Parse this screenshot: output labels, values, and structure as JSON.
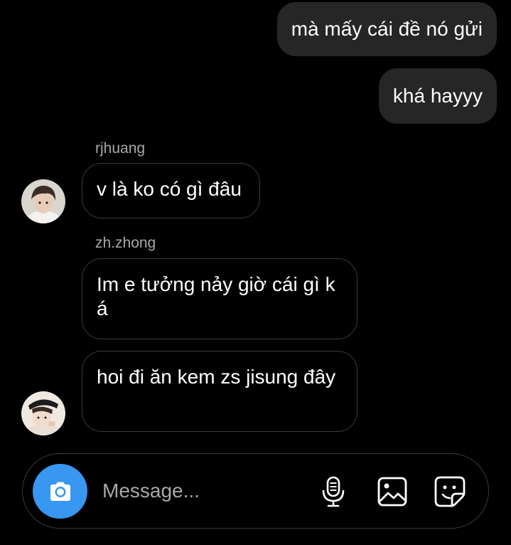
{
  "messages": [
    {
      "type": "outgoing",
      "text": "mà mấy cái đề nó gửi"
    },
    {
      "type": "outgoing",
      "text": "khá hayyy"
    },
    {
      "type": "sender",
      "text": "rjhuang"
    },
    {
      "type": "incoming",
      "text": "v là ko có gì đâu"
    },
    {
      "type": "sender",
      "text": "zh.zhong"
    },
    {
      "type": "incoming",
      "text": "Im e tưởng nảy giờ cái gì k á"
    },
    {
      "type": "incoming",
      "text": "hoi đi ăn kem zs jisung đây"
    }
  ],
  "composer": {
    "placeholder": "Message..."
  },
  "icons": {
    "camera": "camera-icon",
    "mic": "microphone-icon",
    "gallery": "image-gallery-icon",
    "sticker": "sticker-icon"
  },
  "colors": {
    "accent": "#3897f0",
    "outgoing_bubble": "#262626",
    "background": "#000000"
  }
}
